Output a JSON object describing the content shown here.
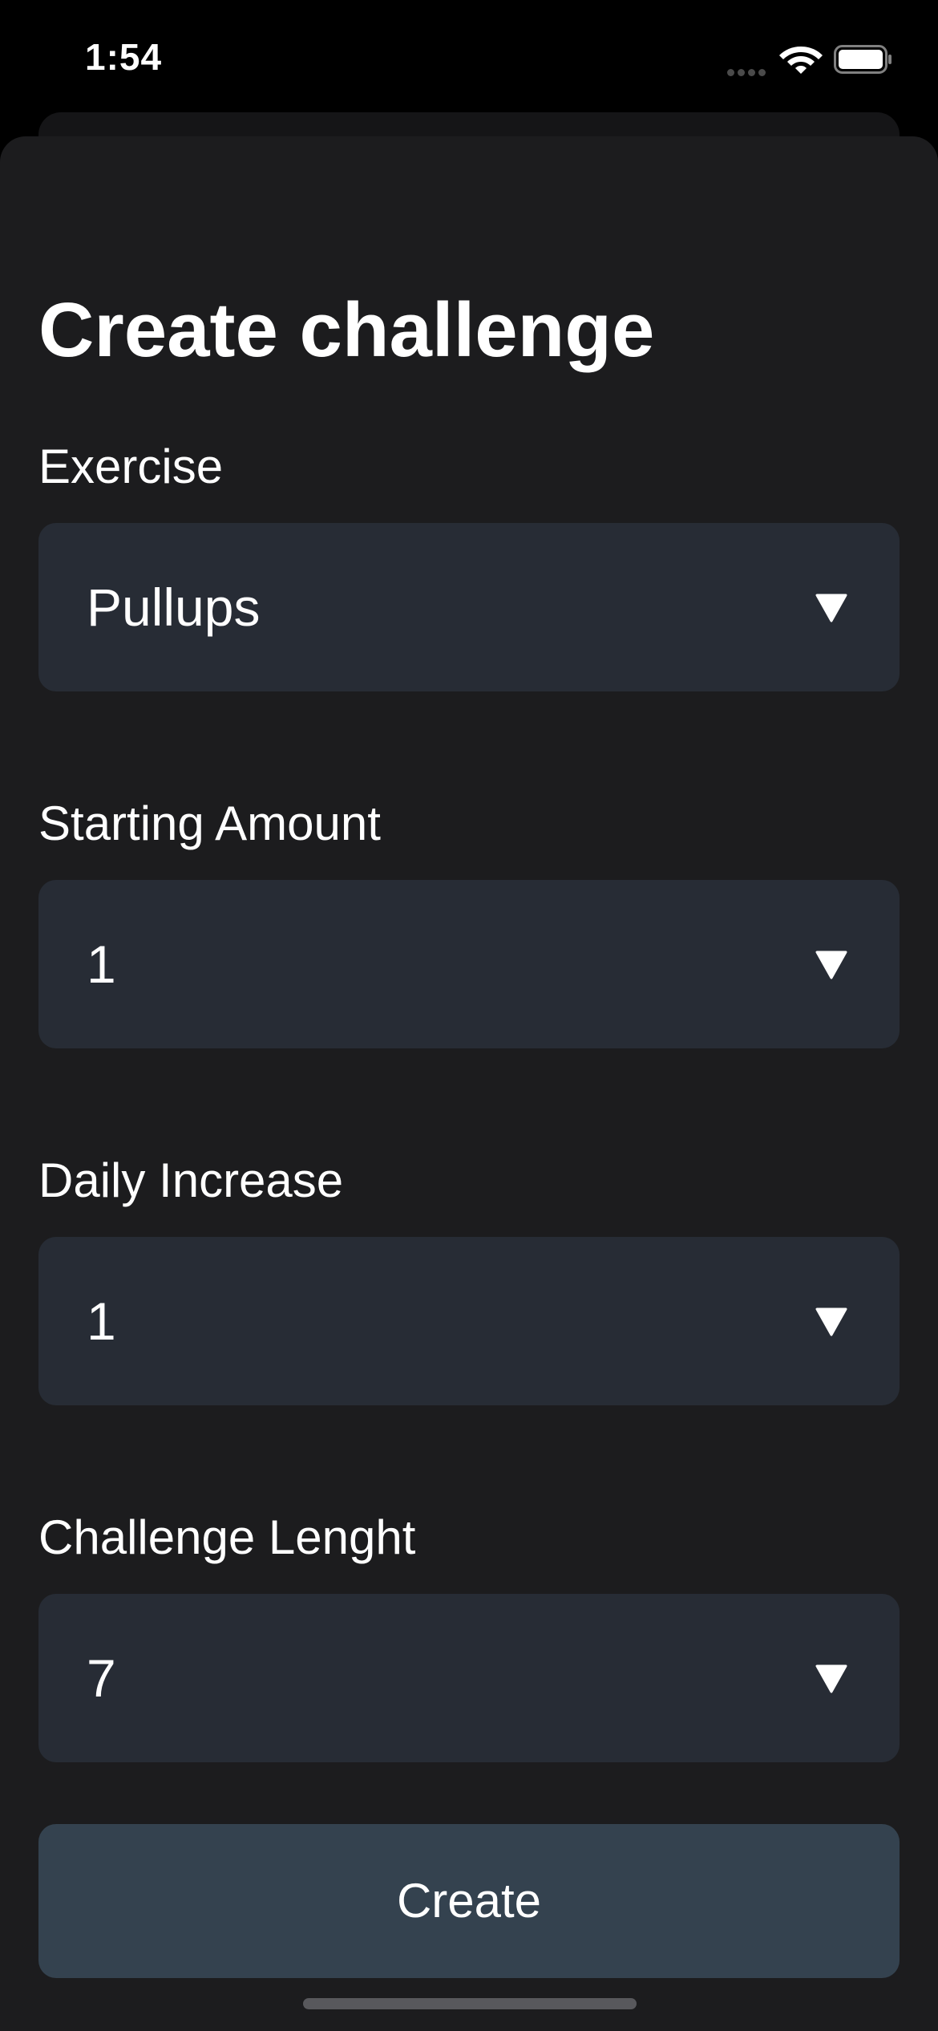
{
  "status_bar": {
    "time": "1:54"
  },
  "header": {
    "title": "Create challenge"
  },
  "form": {
    "fields": [
      {
        "label": "Exercise",
        "value": "Pullups"
      },
      {
        "label": "Starting Amount",
        "value": "1"
      },
      {
        "label": "Daily Increase",
        "value": "1"
      },
      {
        "label": "Challenge Lenght",
        "value": "7"
      }
    ],
    "submit_label": "Create"
  },
  "colors": {
    "background": "#000000",
    "sheet": "#1c1c1e",
    "field": "#272c35",
    "button": "#34424f",
    "text": "#ffffff"
  },
  "icons": {
    "dropdown": "chevron-down-icon",
    "wifi": "wifi-icon",
    "battery": "battery-icon",
    "signal": "signal-icon"
  }
}
